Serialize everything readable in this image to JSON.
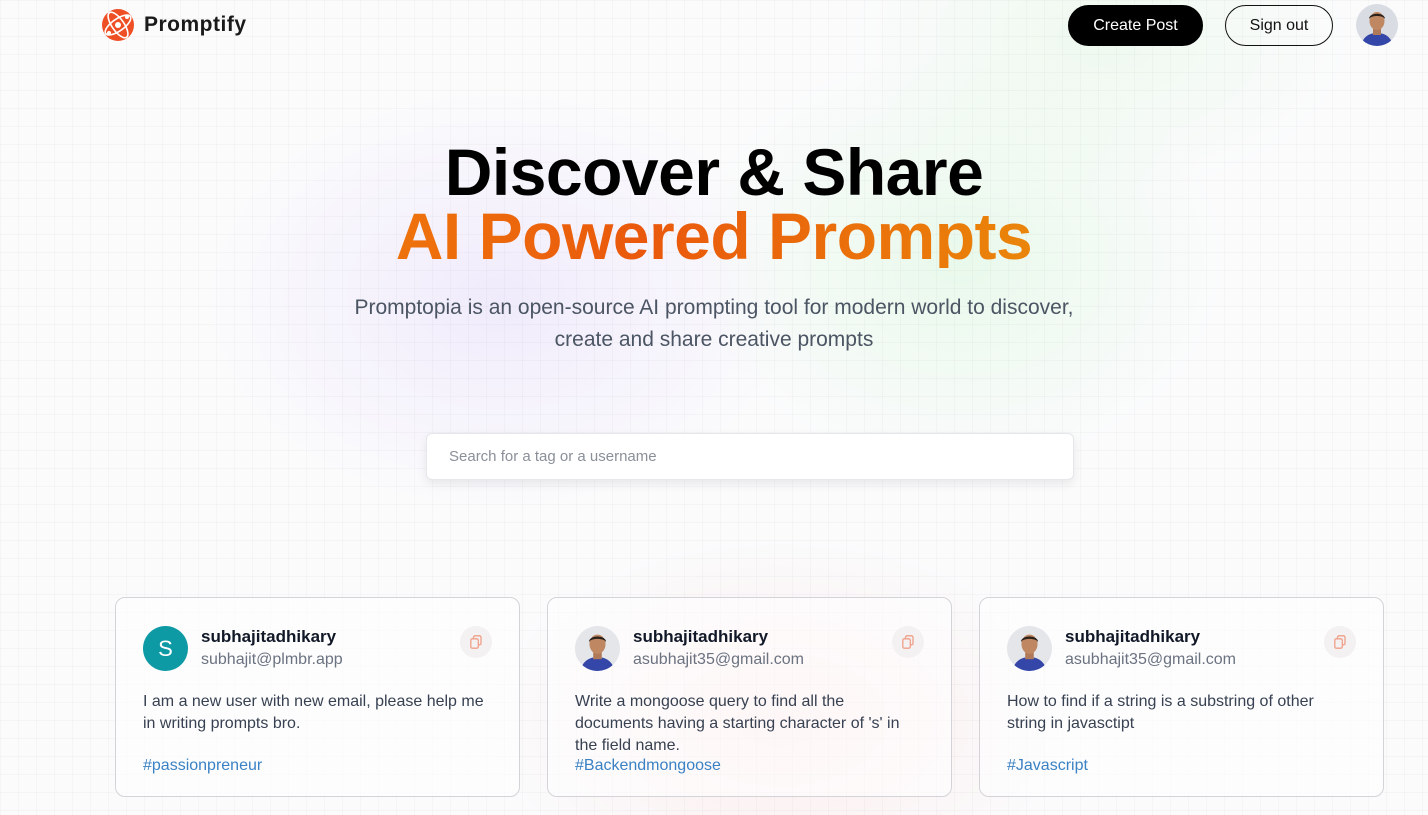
{
  "nav": {
    "brand": "Promptify",
    "create_label": "Create Post",
    "signout_label": "Sign out"
  },
  "hero": {
    "title_line1": "Discover & Share",
    "title_line2": "AI Powered Prompts",
    "description": "Promptopia is an open-source AI prompting tool for modern world to discover, create and share creative prompts"
  },
  "search": {
    "placeholder": "Search for a tag or a username",
    "value": ""
  },
  "cards": [
    {
      "avatar_letter": "S",
      "username": "subhajitadhikary",
      "email": "subhajit@plmbr.app",
      "prompt": "I am a new user with new email, please help me in writing prompts bro.",
      "tag": "#passionpreneur"
    },
    {
      "username": "subhajitadhikary",
      "email": "asubhajit35@gmail.com",
      "prompt": "Write a mongoose query to find all the documents having a starting character of 's' in the field name.",
      "tag": "#Backendmongoose"
    },
    {
      "username": "subhajitadhikary",
      "email": "asubhajit35@gmail.com",
      "prompt": "How to find if a string is a substring of other string in javasctipt",
      "tag": "#Javascript"
    }
  ],
  "colors": {
    "accent_gradient": [
      "#f59e0b",
      "#ea580c",
      "#eab308"
    ],
    "tag_color": "#3b82c4",
    "letter_avatar": "#0e9aa4"
  }
}
